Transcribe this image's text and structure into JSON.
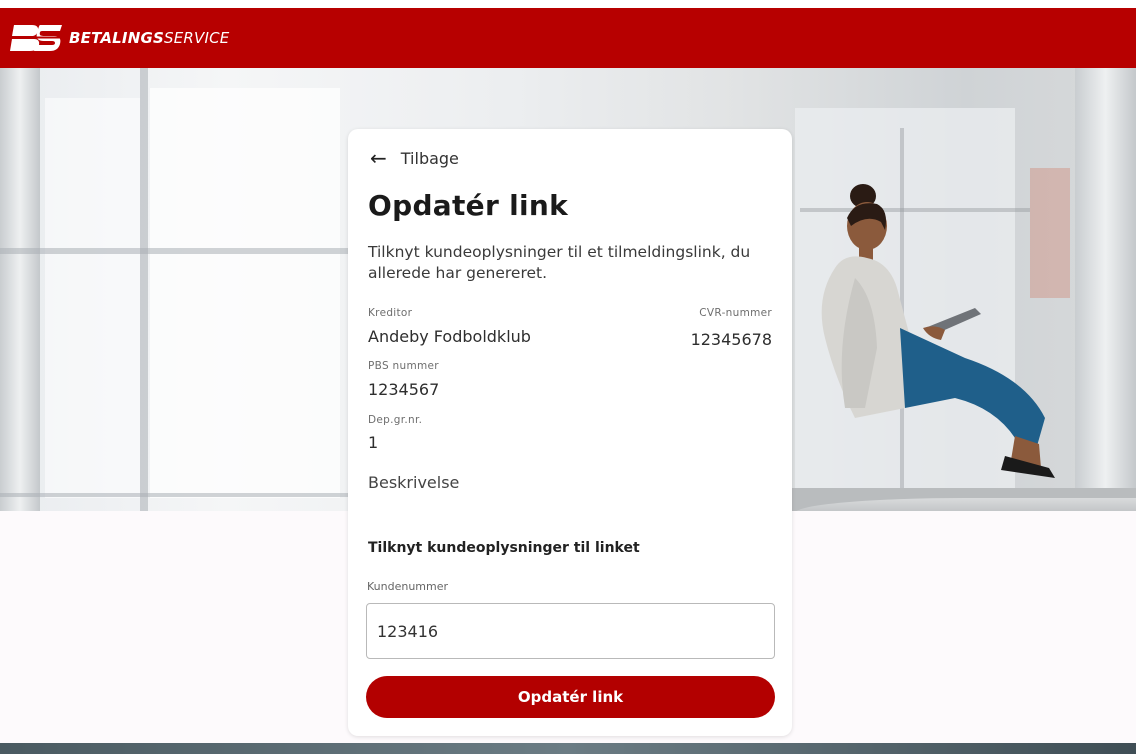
{
  "header": {
    "brand_bold": "BETALINGS",
    "brand_light": "SERVICE",
    "bg_color": "#b70000"
  },
  "card": {
    "back_label": "Tilbage",
    "title": "Opdatér link",
    "description": "Tilknyt kundeoplysninger til et tilmeldingslink, du allerede har genereret.",
    "creditor_label": "Kreditor",
    "creditor_value": "Andeby Fodboldklub",
    "cvr_label": "CVR-nummer",
    "cvr_value": "12345678",
    "pbs_label": "PBS nummer",
    "pbs_value": "1234567",
    "dep_label": "Dep.gr.nr.",
    "dep_value": "1",
    "description_label": "Beskrivelse",
    "section_title": "Tilknyt kundeoplysninger til linket",
    "customer_number_label": "Kundenummer",
    "customer_number_value": "123416",
    "submit_label": "Opdatér link",
    "accent_color": "#b30000"
  },
  "icons": {
    "back": "arrow-left-icon",
    "logo": "bs-logo-icon"
  }
}
